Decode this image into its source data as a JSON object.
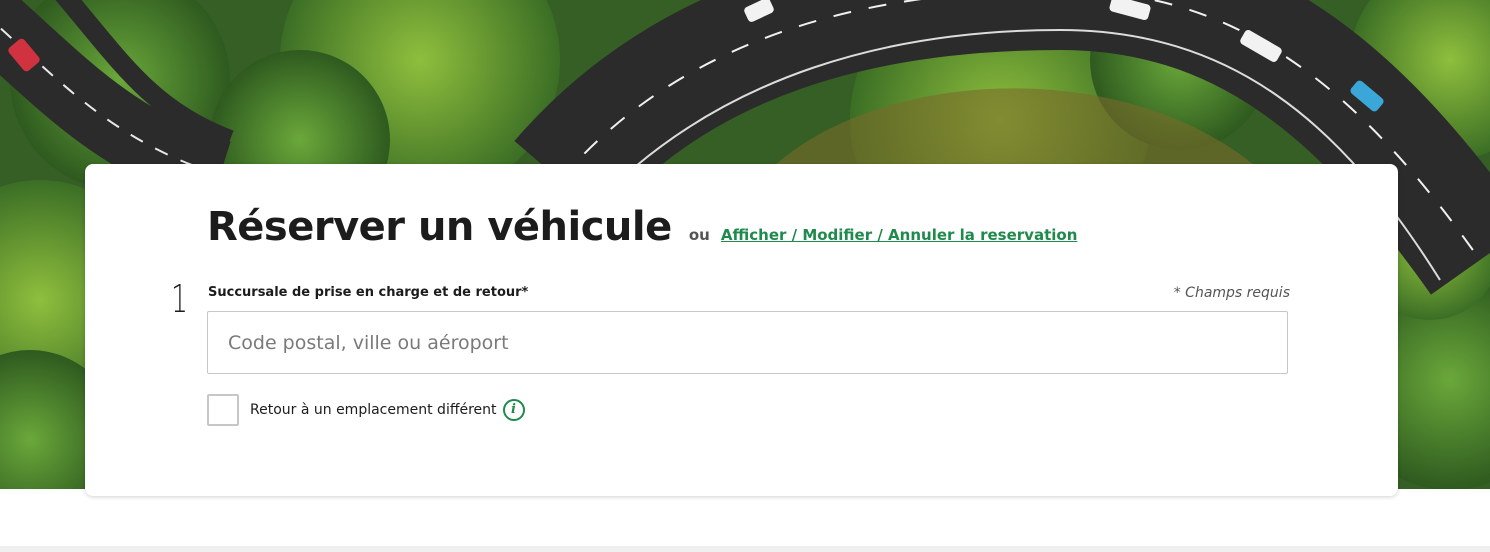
{
  "booking": {
    "title": "Réserver un véhicule",
    "or_text": "ou",
    "manage_link": "Afficher / Modifier / Annuler la reservation",
    "step_number": "1",
    "location_label": "Succursale de prise en charge et de retour*",
    "required_note": "* Champs requis",
    "location_placeholder": "Code postal, ville ou aéroport",
    "location_value": "",
    "different_return_label": "Retour à un emplacement différent",
    "different_return_checked": false
  },
  "icons": {
    "info": "info-icon"
  },
  "colors": {
    "accent": "#1f8a4c",
    "text": "#1c1c1c",
    "border": "#c7c7c7"
  }
}
